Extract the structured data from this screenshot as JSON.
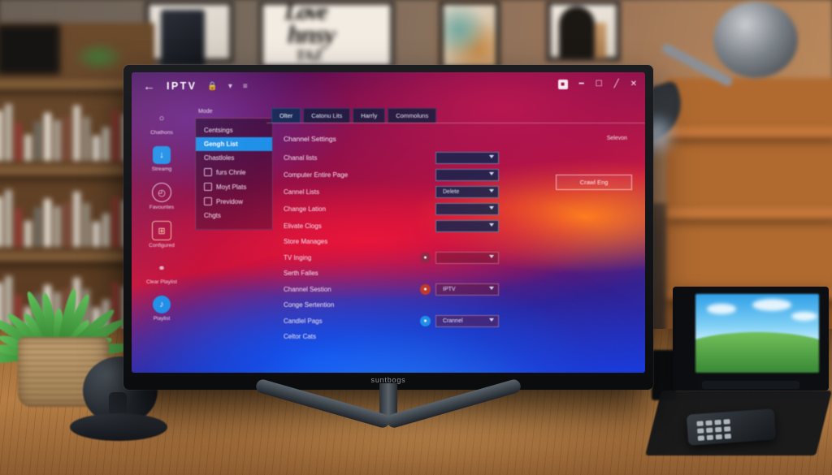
{
  "scene": {
    "description": "Desktop monitor on a wooden desk displaying an IPTV settings application",
    "monitor_brand": "suntbogs"
  },
  "app": {
    "titlebar": {
      "back_icon": "back-arrow-icon",
      "title": "IPTV",
      "icons": [
        "lock-icon",
        "chevron-down-icon",
        "list-icon"
      ],
      "window_controls": [
        {
          "name": "badge-icon",
          "glyph": "■"
        },
        {
          "name": "minimize-icon",
          "glyph": "–"
        },
        {
          "name": "maximize-icon",
          "glyph": "□"
        },
        {
          "name": "edit-pen-icon",
          "glyph": "╱"
        },
        {
          "name": "close-icon",
          "glyph": "✕"
        }
      ]
    },
    "sidebar": {
      "items": [
        {
          "label": "Chathons",
          "icon": "chat-bubble-icon",
          "style": "plain",
          "glyph": "○",
          "active": false
        },
        {
          "label": "Streamg",
          "icon": "download-icon",
          "style": "boxed",
          "glyph": "↓",
          "active": true
        },
        {
          "label": "Favourites",
          "icon": "clock-icon",
          "style": "round",
          "glyph": "◴",
          "active": false
        },
        {
          "label": "Configured",
          "icon": "grid-settings-icon",
          "style": "sq",
          "glyph": "⊞",
          "active": false
        },
        {
          "label": "Clear Playlist",
          "icon": "link-chain-icon",
          "style": "plain",
          "glyph": "⚭",
          "active": false
        },
        {
          "label": "Playlist",
          "icon": "media-play-icon",
          "style": "blue",
          "glyph": "♪",
          "active": false
        }
      ]
    },
    "mode_label": "Mode",
    "menu": {
      "items": [
        {
          "label": "Centsings",
          "icon": null,
          "active": false
        },
        {
          "label": "Gengh List",
          "icon": null,
          "active": true
        },
        {
          "label": "Chastloles",
          "icon": null,
          "active": false
        },
        {
          "label": "furs Chnle",
          "icon": "file-icon",
          "active": false
        },
        {
          "label": "Moyt Plats",
          "icon": "file-icon",
          "active": false
        },
        {
          "label": "Previdow",
          "icon": "file-icon",
          "active": false
        },
        {
          "label": "Chgts",
          "icon": null,
          "active": false
        }
      ]
    },
    "tabs": [
      {
        "label": "Olter",
        "active": true
      },
      {
        "label": "Catonu Lits",
        "active": false
      },
      {
        "label": "Harrly",
        "active": false
      },
      {
        "label": "Commoluns",
        "active": false
      }
    ],
    "content": {
      "section_title": "Channel Settings",
      "rows": [
        {
          "label": "Chanal lists",
          "type": "select",
          "value": "",
          "icon": null,
          "variant": "cool"
        },
        {
          "label": "Computer Entire Page",
          "type": "select",
          "value": "",
          "icon": null,
          "variant": "cool"
        },
        {
          "label": "Cannel Lists",
          "type": "select",
          "value": "Delete",
          "icon": null,
          "variant": "cool"
        },
        {
          "label": "Change Lation",
          "type": "select",
          "value": "",
          "icon": null,
          "variant": "cool"
        },
        {
          "label": "Elivate Clogs",
          "type": "select",
          "value": "",
          "icon": null,
          "variant": "cool"
        },
        {
          "label": "Store Manages",
          "type": "sublabel"
        },
        {
          "label": "TV Inging",
          "type": "select",
          "value": "",
          "icon": "clock-icon",
          "icon_color": "#8f2a46",
          "variant": "warm"
        },
        {
          "label": "Serth Falles",
          "type": "sublabel"
        },
        {
          "label": "Channel Sestion",
          "type": "select",
          "value": "IPTV",
          "icon": "smiley-icon",
          "icon_color": "#c0392b",
          "variant": "warm"
        },
        {
          "label": "Conge Sertention",
          "type": "sublabel"
        },
        {
          "label": "Candlel Pags",
          "type": "select",
          "value": "Crannel",
          "icon": "grid-icon",
          "icon_color": "#1f8fe8",
          "variant": "warm"
        },
        {
          "label": "Celtor Cats",
          "type": "sublabel"
        }
      ]
    },
    "right_panel": {
      "label": "Selevon",
      "button_label": "Crawl Eng"
    }
  },
  "colors": {
    "accent_blue": "#1f8fe8",
    "wallpaper_magenta": "#c4123b",
    "wallpaper_blue": "#0a2bd6",
    "wallpaper_purple": "#3a0b55",
    "select_bg": "#0d264e"
  }
}
